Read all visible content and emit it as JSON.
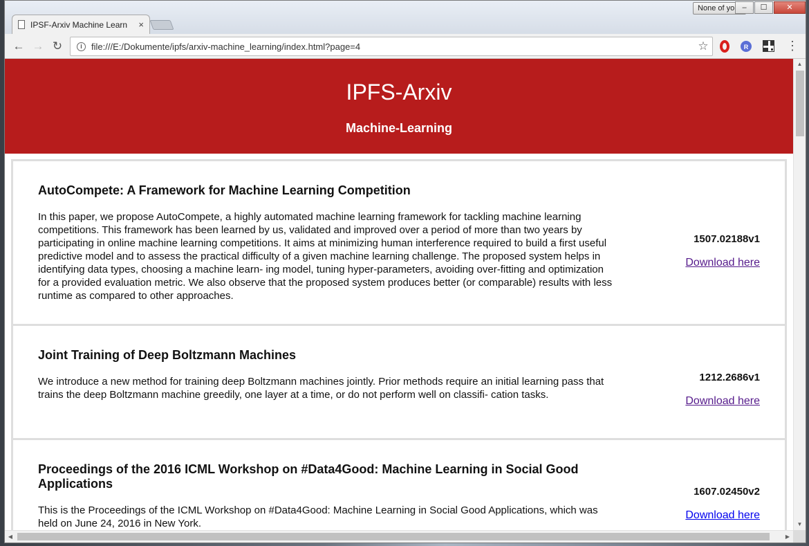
{
  "browser": {
    "profile_label": "None of your",
    "tab_title": "IPSF-Arxiv Machine Learn",
    "tab_close": "×",
    "url": "file:///E:/Dokumente/ipfs/arxiv-machine_learning/index.html?page=4",
    "window_controls": {
      "minimize": "–",
      "maximize": "☐",
      "close": "✕"
    },
    "nav": {
      "back": "←",
      "forward": "→",
      "reload": "↻"
    },
    "icons": {
      "info": "i",
      "star": "☆",
      "menu": "⋮",
      "ext_r": "R"
    }
  },
  "site": {
    "title": "IPFS-Arxiv",
    "subtitle": "Machine-Learning"
  },
  "papers": [
    {
      "title": "AutoCompete: A Framework for Machine Learning Competition",
      "abstract": "In this paper, we propose AutoCompete, a highly automated machine learning framework for tackling machine learning competitions. This framework has been learned by us, validated and improved over a period of more than two years by participating in online machine learning competitions. It aims at minimizing human interference required to build a first useful predictive model and to assess the practical difficulty of a given machine learning challenge. The proposed system helps in identifying data types, choosing a machine learn- ing model, tuning hyper-parameters, avoiding over-fitting and optimization for a provided evaluation metric. We also observe that the proposed system produces better (or comparable) results with less runtime as compared to other approaches.",
      "arxiv_id": "1507.02188v1",
      "download_label": "Download here"
    },
    {
      "title": "Joint Training of Deep Boltzmann Machines",
      "abstract": "We introduce a new method for training deep Boltzmann machines jointly. Prior methods require an initial learning pass that trains the deep Boltzmann machine greedily, one layer at a time, or do not perform well on classifi- cation tasks.",
      "arxiv_id": "1212.2686v1",
      "download_label": "Download here"
    },
    {
      "title": "Proceedings of the 2016 ICML Workshop on #Data4Good: Machine Learning in Social Good Applications",
      "abstract": "This is the Proceedings of the ICML Workshop on #Data4Good: Machine Learning in Social Good Applications, which was held on June 24, 2016 in New York.",
      "arxiv_id": "1607.02450v2",
      "download_label": "Download here"
    }
  ],
  "scrollbar": {
    "up": "▲",
    "down": "▼",
    "left": "◀",
    "right": "▶"
  }
}
